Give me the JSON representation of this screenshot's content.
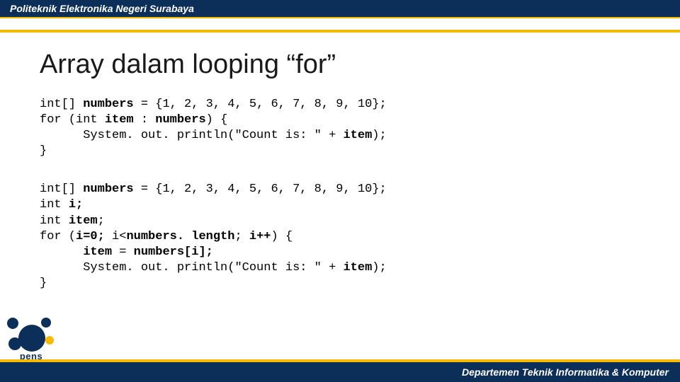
{
  "header": {
    "institution": "Politeknik Elektronika Negeri Surabaya"
  },
  "title": "Array dalam looping “for”",
  "code1": {
    "l0_a": "int[] ",
    "l0_b": "numbers",
    "l0_c": " = {1, 2, 3, 4, 5, 6, 7, 8, 9, 10};",
    "l1_a": "for (int ",
    "l1_b": "item",
    "l1_c": " : ",
    "l1_d": "numbers",
    "l1_e": ") {",
    "l2_a": "      System. out. println(\"Count is: \" + ",
    "l2_b": "item",
    "l2_c": ");",
    "l3": "}"
  },
  "code2": {
    "l0_a": "int[] ",
    "l0_b": "numbers",
    "l0_c": " = {1, 2, 3, 4, 5, 6, 7, 8, 9, 10};",
    "l1_a": "int ",
    "l1_b": "i;",
    "l2_a": "int ",
    "l2_b": "item",
    "l2_c": ";",
    "l3_a": "for (",
    "l3_b": "i=0;",
    "l3_c": " i<",
    "l3_d": "numbers. length",
    "l3_e": "; ",
    "l3_f": "i++",
    "l3_g": ") {",
    "l4_a": "      ",
    "l4_b": "item",
    "l4_c": " = ",
    "l4_d": "numbers[i];",
    "l5_a": "      System. out. println(\"Count is: \" + ",
    "l5_b": "item",
    "l5_c": ");",
    "l6": "}"
  },
  "logo": {
    "text": "pens"
  },
  "footer": {
    "department": "Departemen Teknik Informatika & Komputer"
  }
}
